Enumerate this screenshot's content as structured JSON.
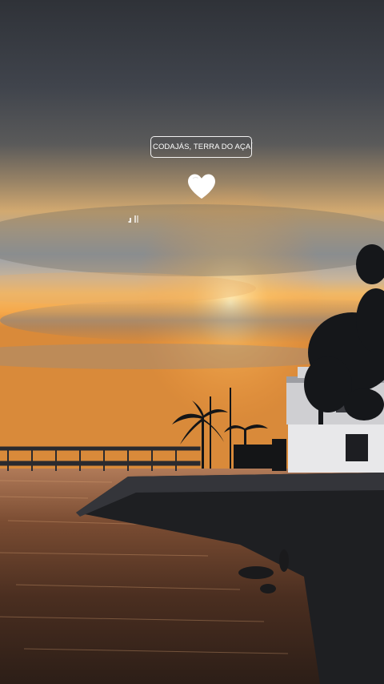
{
  "story": {
    "location_sticker": {
      "label": "CODAJÁS, TERRA DO AÇAÍ",
      "icon": "map-pin-icon"
    },
    "heart_sticker": {
      "icon": "white-heart-icon",
      "color": "#ffffff"
    },
    "music_indicator": {
      "icon": "music-note-icon"
    },
    "photo": {
      "subject": "sunset over river with pier, palm trees and building",
      "colors": {
        "sky_top": "#3f434c",
        "sunset_glow": "#f2b25a",
        "water": "#4a3022",
        "silhouette": "#15171a"
      }
    }
  }
}
